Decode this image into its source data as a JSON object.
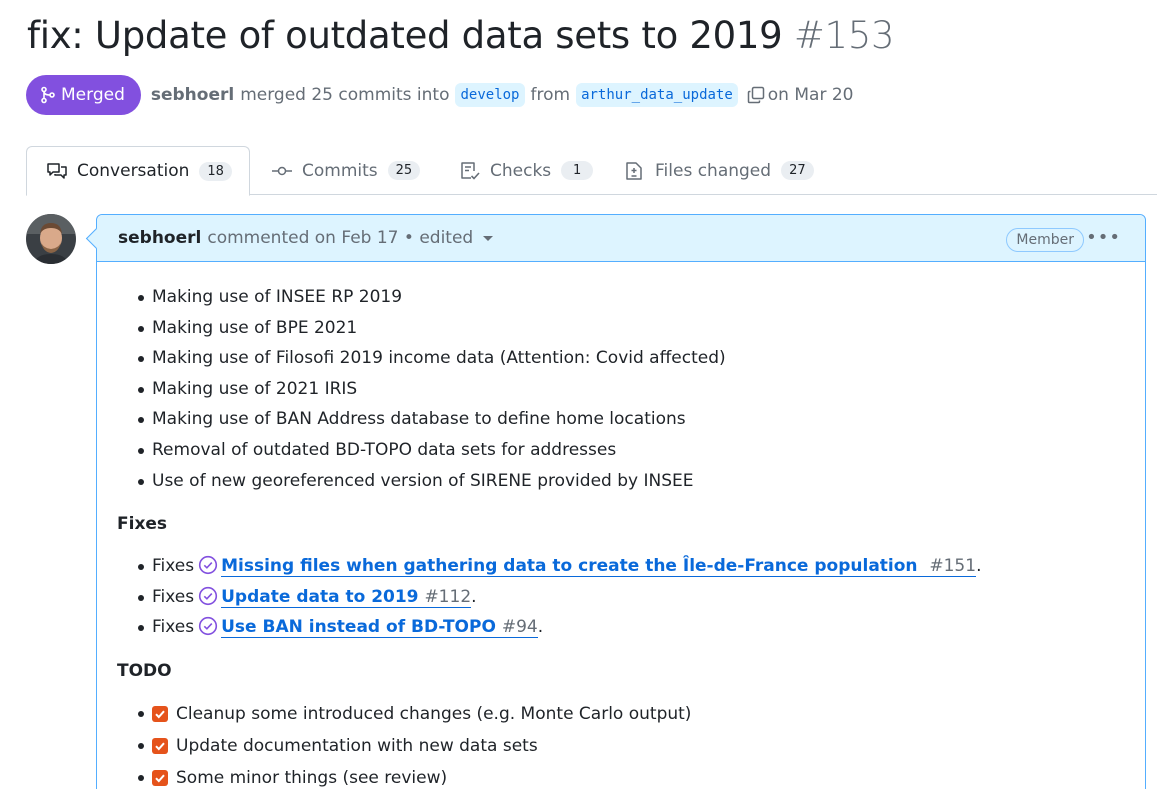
{
  "pr": {
    "title": "fix: Update of outdated data sets to 2019",
    "number": "#153",
    "status": "Merged",
    "author": "sebhoerl",
    "merge_text": "merged 25 commits into",
    "base_branch": "develop",
    "from_text": "from",
    "head_branch": "arthur_data_update",
    "date_text": "on Mar 20"
  },
  "tabs": [
    {
      "label": "Conversation",
      "count": "18",
      "icon": "comment-discussion-icon"
    },
    {
      "label": "Commits",
      "count": "25",
      "icon": "git-commit-icon"
    },
    {
      "label": "Checks",
      "count": "1",
      "icon": "checklist-icon"
    },
    {
      "label": "Files changed",
      "count": "27",
      "icon": "file-diff-icon"
    }
  ],
  "comment": {
    "author": "sebhoerl",
    "meta": "commented on Feb 17 • edited",
    "badge": "Member",
    "bullets": [
      "Making use of INSEE RP 2019",
      "Making use of BPE 2021",
      "Making use of Filosofi 2019 income data (Attention: Covid affected)",
      "Making use of 2021 IRIS",
      "Making use of BAN Address database to define home locations",
      "Removal of outdated BD-TOPO data sets for addresses",
      "Use of new georeferenced version of SIRENE provided by INSEE"
    ],
    "fixes_heading": "Fixes",
    "fixes": [
      {
        "prefix": "Fixes",
        "title": "Missing files when gathering data to create the Île-de-France population",
        "number": "#151",
        "suffix": "."
      },
      {
        "prefix": "Fixes",
        "title": "Update data to 2019",
        "number": "#112",
        "suffix": "."
      },
      {
        "prefix": "Fixes",
        "title": "Use BAN instead of BD-TOPO",
        "number": "#94",
        "suffix": "."
      }
    ],
    "todo_heading": "TODO",
    "todos": [
      "Cleanup some introduced changes (e.g. Monte Carlo output)",
      "Update documentation with new data sets",
      "Some minor things (see review)"
    ]
  },
  "colors": {
    "merged": "#8250df",
    "link": "#0969da",
    "header_bg": "#ddf4ff",
    "checkbox": "#e5531b"
  }
}
